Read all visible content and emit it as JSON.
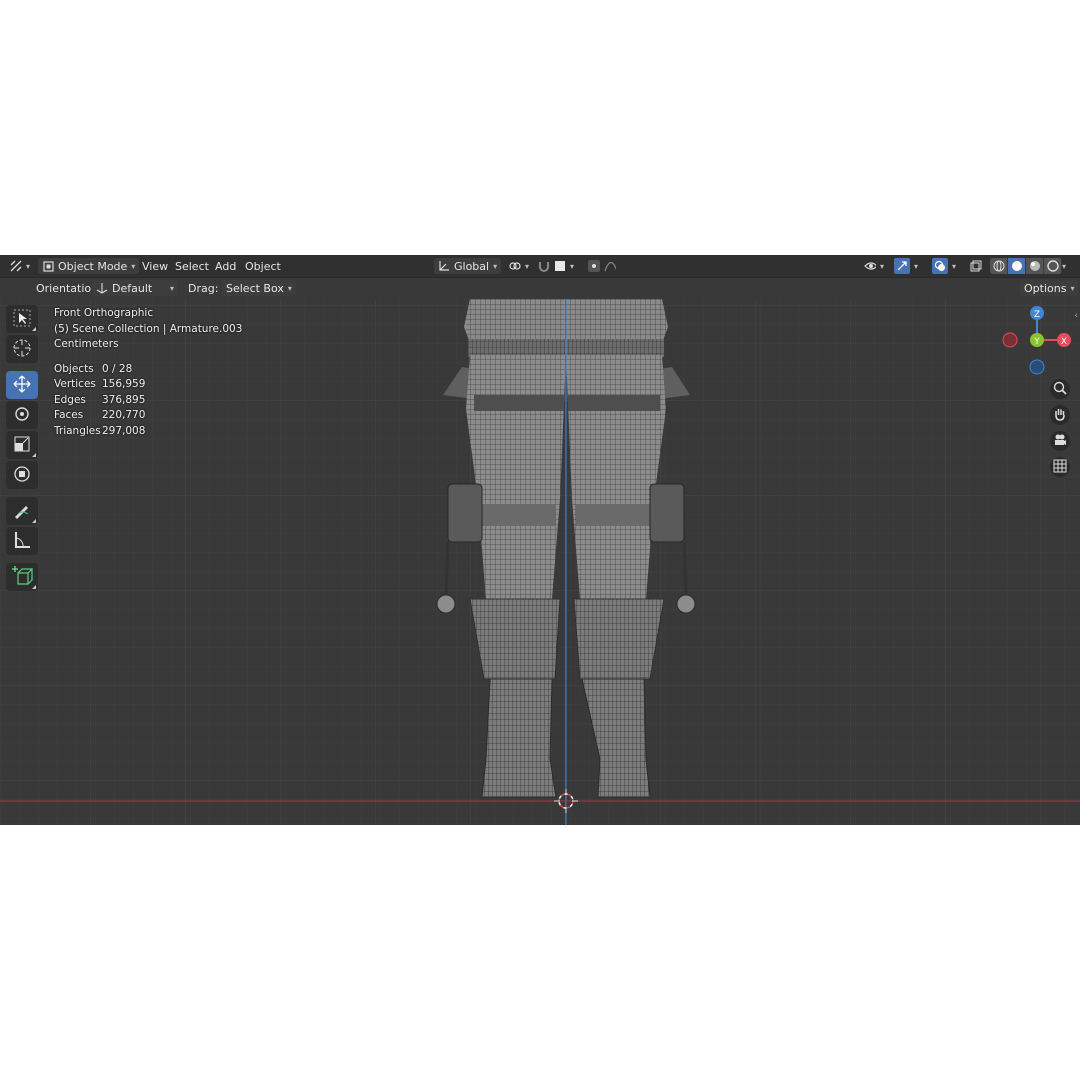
{
  "header": {
    "editor_type_icon": "editor-type-icon",
    "mode": "Object Mode",
    "menus": [
      "View",
      "Select",
      "Add",
      "Object"
    ],
    "transform_orientation": "Global",
    "options_label": "Options"
  },
  "tool_settings": {
    "orientation_label": "Orientation:",
    "orientation_value": "Default",
    "drag_label": "Drag:",
    "drag_value": "Select Box"
  },
  "toolbar": {
    "tools": [
      "select-box-icon",
      "cursor-icon",
      "move-icon",
      "rotate-icon",
      "scale-icon",
      "transform-icon",
      "annotate-icon",
      "measure-icon",
      "add-cube-icon"
    ],
    "active": "move-icon"
  },
  "viewport": {
    "view_name": "Front Orthographic",
    "collection": "(5) Scene Collection | Armature.003",
    "units": "Centimeters",
    "stats": [
      {
        "label": "Objects",
        "value": "0 / 28"
      },
      {
        "label": "Vertices",
        "value": "156,959"
      },
      {
        "label": "Edges",
        "value": "376,895"
      },
      {
        "label": "Faces",
        "value": "220,770"
      },
      {
        "label": "Triangles",
        "value": "297,008"
      }
    ]
  },
  "gizmo": {
    "axes": {
      "z": "Z",
      "y": "Y",
      "x": "X"
    },
    "colors": {
      "x": "#e84b5d",
      "y": "#8bc42b",
      "z": "#3f86d4"
    },
    "buttons": [
      "zoom-icon",
      "hand-icon",
      "camera-icon",
      "grid-icon"
    ]
  },
  "colors": {
    "viewport_bg": "#393939",
    "header_bg": "#303030",
    "accent": "#4772b3",
    "mesh": "#8a8a8a"
  }
}
